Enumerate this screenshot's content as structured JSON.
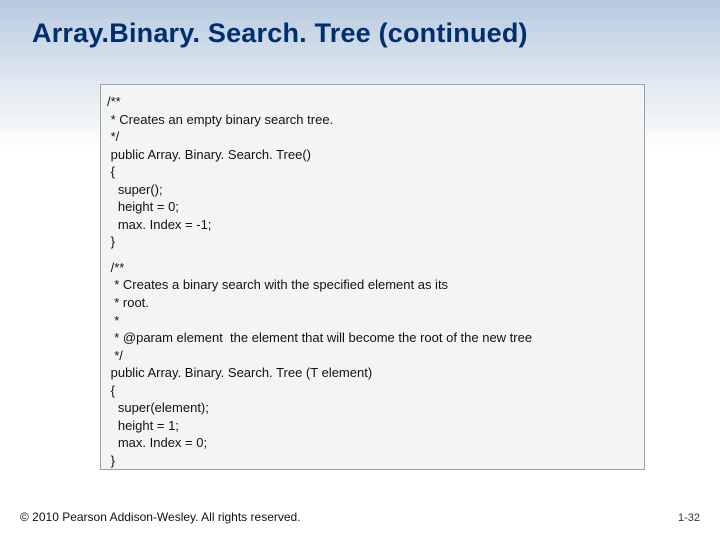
{
  "title": "Array.Binary. Search. Tree (continued)",
  "code": {
    "lines": [
      "/**",
      " * Creates an empty binary search tree.",
      " */",
      " public Array. Binary. Search. Tree() ",
      " {",
      "   super();",
      "   height = 0;",
      "   max. Index = -1;",
      " }",
      "",
      " /**",
      "  * Creates a binary search with the specified element as its",
      "  * root.",
      "  *",
      "  * @param element  the element that will become the root of the new tree",
      "  */",
      " public Array. Binary. Search. Tree (T element) ",
      " {",
      "   super(element);",
      "   height = 1;",
      "   max. Index = 0;",
      " }"
    ]
  },
  "footer": {
    "copyright": "© 2010 Pearson Addison-Wesley. All rights reserved.",
    "pagenum": "1-32"
  }
}
